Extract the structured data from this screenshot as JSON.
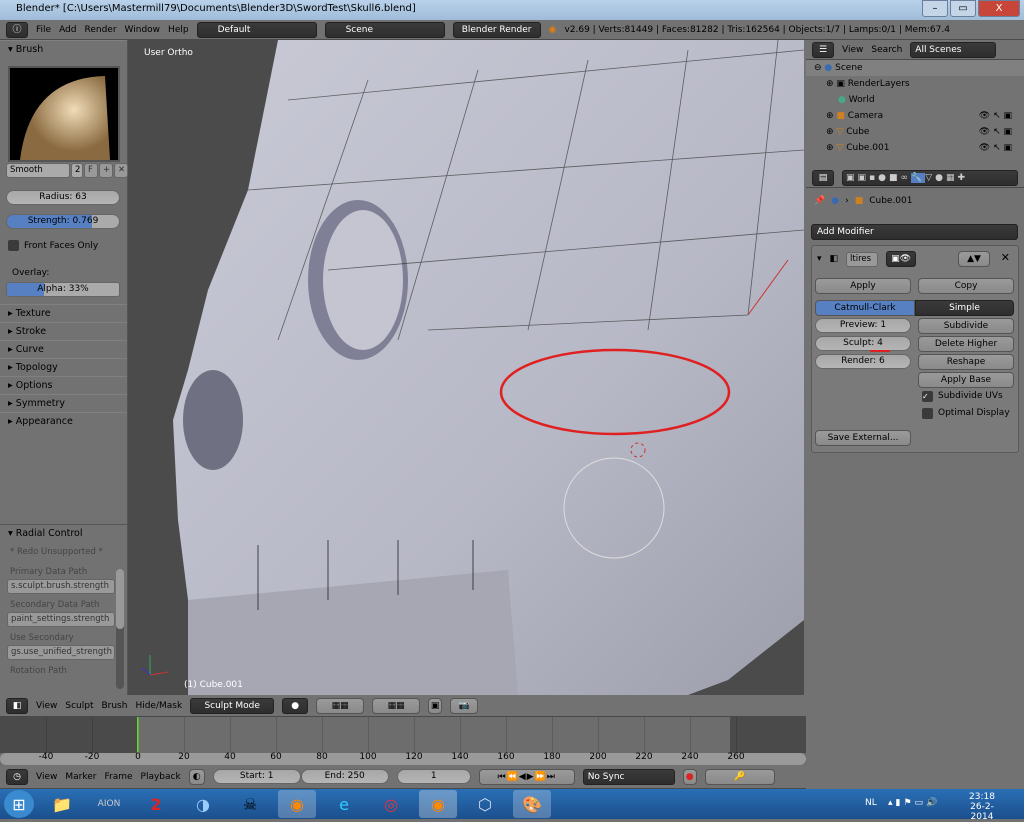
{
  "window": {
    "title": "Blender* [C:\\Users\\Mastermill79\\Documents\\Blender3D\\SwordTest\\Skull6.blend]",
    "minimize": "–",
    "maximize": "▭",
    "close": "X"
  },
  "info_header": {
    "menus": [
      "File",
      "Add",
      "Render",
      "Window",
      "Help"
    ],
    "layout": "Default",
    "scene": "Scene",
    "engine": "Blender Render",
    "stats": "v2.69 | Verts:81449 | Faces:81282 | Tris:162564 | Objects:1/7 | Lamps:0/1 | Mem:67.4"
  },
  "toolshelf": {
    "brush_panel": "Brush",
    "brush_name": "Smooth",
    "brush_users": "2",
    "fake_user": "F",
    "radius": "Radius: 63",
    "strength": "Strength: 0.769",
    "front_faces_only": "Front Faces Only",
    "overlay_label": "Overlay:",
    "alpha": "Alpha: 33%",
    "panels": [
      "Texture",
      "Stroke",
      "Curve",
      "Topology",
      "Options",
      "Symmetry",
      "Appearance"
    ],
    "radial": {
      "title": "Radial Control",
      "redo": "* Redo Unsupported *",
      "fields": [
        {
          "label": "Primary Data Path",
          "value": "s.sculpt.brush.strength"
        },
        {
          "label": "Secondary Data Path",
          "value": "paint_settings.strength"
        },
        {
          "label": "Use Secondary",
          "value": "gs.use_unified_strength"
        },
        {
          "label": "Rotation Path",
          "value": ""
        }
      ]
    }
  },
  "viewport": {
    "view_name": "User Ortho",
    "object_label": "(1) Cube.001"
  },
  "outliner": {
    "menus": [
      "View",
      "Search"
    ],
    "filter": "All Scenes",
    "items": [
      {
        "name": "Scene",
        "level": 0
      },
      {
        "name": "RenderLayers",
        "level": 1
      },
      {
        "name": "World",
        "level": 1
      },
      {
        "name": "Camera",
        "level": 1
      },
      {
        "name": "Cube",
        "level": 1
      },
      {
        "name": "Cube.001",
        "level": 1
      }
    ]
  },
  "properties": {
    "object": "Cube.001",
    "add_modifier": "Add Modifier",
    "modifier_name": "ltires",
    "apply": "Apply",
    "copy": "Copy",
    "catmull": "Catmull-Clark",
    "simple": "Simple",
    "preview": "Preview: 1",
    "sculpt": "Sculpt: 4",
    "render": "Render: 6",
    "subdivide": "Subdivide",
    "delete_higher": "Delete Higher",
    "reshape": "Reshape",
    "apply_base": "Apply Base",
    "subdivide_uvs": "Subdivide UVs",
    "subdivide_uvs_checked": true,
    "optimal_display": "Optimal Display",
    "optimal_display_checked": false,
    "save_external": "Save External..."
  },
  "view3d_header": {
    "menus": [
      "View",
      "Sculpt",
      "Brush",
      "Hide/Mask"
    ],
    "mode": "Sculpt Mode"
  },
  "timeline": {
    "ticks": [
      "-40",
      "-20",
      "0",
      "20",
      "40",
      "60",
      "80",
      "100",
      "120",
      "140",
      "160",
      "180",
      "200",
      "220",
      "240",
      "260"
    ],
    "current_frame_marker": 0
  },
  "timeline_header": {
    "menus": [
      "View",
      "Marker",
      "Frame",
      "Playback"
    ],
    "start": "Start: 1",
    "end": "End: 250",
    "frame": "1",
    "sync": "No Sync"
  },
  "taskbar": {
    "apps": [
      "Windows Explorer",
      "Aion",
      "Guild Wars 2",
      "TeamSpeak",
      "Game",
      "Firefox",
      "Internet Explorer",
      "Chrome",
      "Blender",
      "3D App",
      "Paint"
    ],
    "lang": "NL",
    "time": "23:18",
    "date": "26-2-2014"
  },
  "colors": {
    "accent": "#5680c2",
    "annotation": "#e02020",
    "frame_marker": "#6ecf3a"
  }
}
